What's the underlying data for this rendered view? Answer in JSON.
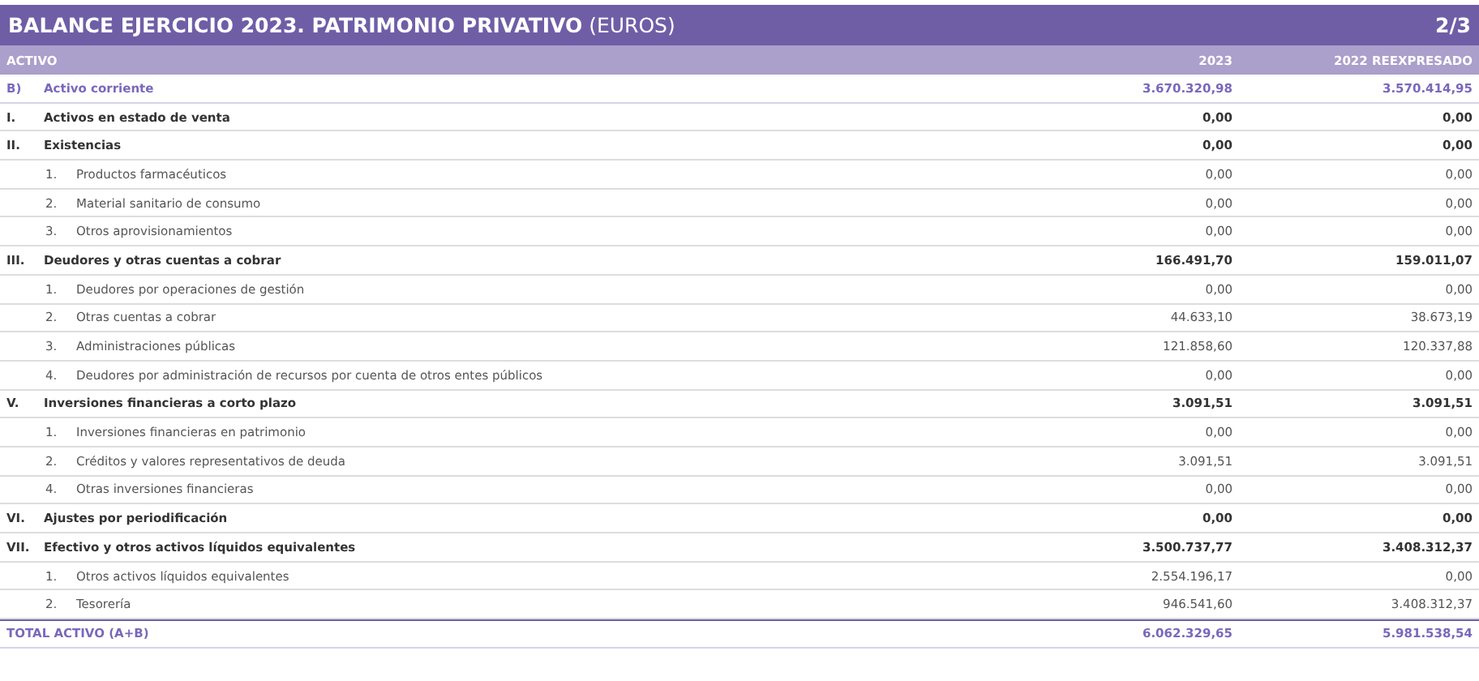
{
  "title": "**BALANCE EJERCICIO 2023. PATRIMONIO PRIVATIVO** (EUROS)",
  "page": "2/3",
  "columns": [
    "ACTIVO",
    "2023",
    "2022 REEXPRESADO"
  ],
  "rows": [
    {
      "kind": "section",
      "number": "B)",
      "label": "Activo corriente",
      "values": [
        "3.670.320,98",
        "3.570.414,95"
      ]
    },
    {
      "kind": "group",
      "number": "I.",
      "label": "Activos en estado de venta",
      "values": [
        "0,00",
        "0,00"
      ]
    },
    {
      "kind": "group",
      "number": "II.",
      "label": "Existencias",
      "values": [
        "0,00",
        "0,00"
      ]
    },
    {
      "kind": "item",
      "number": "1.",
      "label": "Productos farmacéuticos",
      "values": [
        "0,00",
        "0,00"
      ]
    },
    {
      "kind": "item",
      "number": "2.",
      "label": "Material sanitario de consumo",
      "values": [
        "0,00",
        "0,00"
      ]
    },
    {
      "kind": "item",
      "number": "3.",
      "label": "Otros aprovisionamientos",
      "values": [
        "0,00",
        "0,00"
      ]
    },
    {
      "kind": "group",
      "number": "III.",
      "label": "Deudores y otras cuentas a cobrar",
      "values": [
        "166.491,70",
        "159.011,07"
      ]
    },
    {
      "kind": "item",
      "number": "1.",
      "label": "Deudores por operaciones de gestión",
      "values": [
        "0,00",
        "0,00"
      ]
    },
    {
      "kind": "item",
      "number": "2.",
      "label": "Otras cuentas a cobrar",
      "values": [
        "44.633,10",
        "38.673,19"
      ]
    },
    {
      "kind": "item",
      "number": "3.",
      "label": "Administraciones públicas",
      "values": [
        "121.858,60",
        "120.337,88"
      ]
    },
    {
      "kind": "item",
      "number": "4.",
      "label": "Deudores por administración de recursos por cuenta de otros entes públicos",
      "values": [
        "0,00",
        "0,00"
      ]
    },
    {
      "kind": "group",
      "number": "V.",
      "label": "Inversiones financieras a corto plazo",
      "values": [
        "3.091,51",
        "3.091,51"
      ]
    },
    {
      "kind": "item",
      "number": "1.",
      "label": "Inversiones financieras en patrimonio",
      "values": [
        "0,00",
        "0,00"
      ]
    },
    {
      "kind": "item",
      "number": "2.",
      "label": "Créditos y valores representativos de deuda",
      "values": [
        "3.091,51",
        "3.091,51"
      ]
    },
    {
      "kind": "item",
      "number": "4.",
      "label": "Otras inversiones financieras",
      "values": [
        "0,00",
        "0,00"
      ]
    },
    {
      "kind": "group",
      "number": "VI.",
      "label": "Ajustes por periodificación",
      "values": [
        "0,00",
        "0,00"
      ]
    },
    {
      "kind": "group",
      "number": "VII.",
      "label": "Efectivo y otros activos líquidos equivalentes",
      "values": [
        "3.500.737,77",
        "3.408.312,37"
      ]
    },
    {
      "kind": "item",
      "number": "1.",
      "label": "Otros activos líquidos equivalentes",
      "values": [
        "2.554.196,17",
        "0,00"
      ]
    },
    {
      "kind": "item",
      "number": "2.",
      "label": "Tesorería",
      "values": [
        "946.541,60",
        "3.408.312,37"
      ]
    },
    {
      "kind": "total",
      "label": "TOTAL ACTIVO (A+B)",
      "values": [
        "6.062.329,65",
        "5.981.538,54"
      ]
    }
  ]
}
